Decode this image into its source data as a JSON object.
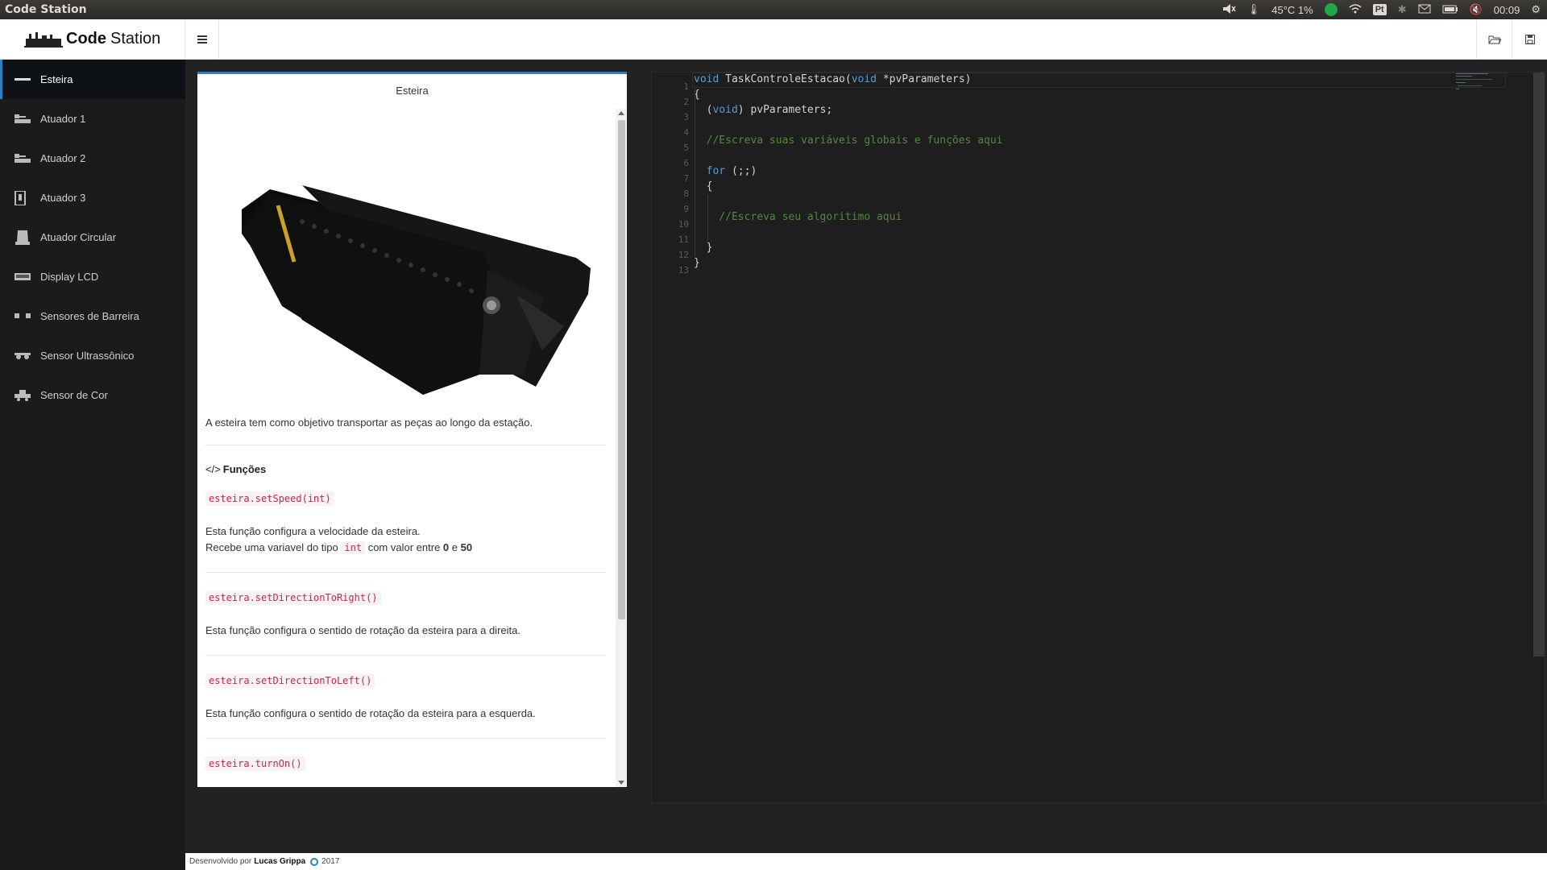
{
  "system_bar": {
    "app_title": "Code Station",
    "temperature": "45°C 1%",
    "keyboard_layout": "Pt",
    "clock": "00:09"
  },
  "header": {
    "brand_bold": "Code",
    "brand_rest": "Station",
    "menu_icon": "hamburger-icon",
    "open_icon": "folder-open-icon",
    "save_icon": "save-icon"
  },
  "sidebar": {
    "items": [
      {
        "label": "Esteira",
        "icon": "conveyor-icon",
        "active": true
      },
      {
        "label": "Atuador 1",
        "icon": "actuator-icon"
      },
      {
        "label": "Atuador 2",
        "icon": "actuator-icon"
      },
      {
        "label": "Atuador 3",
        "icon": "actuator-vertical-icon"
      },
      {
        "label": "Atuador Circular",
        "icon": "circular-actuator-icon"
      },
      {
        "label": "Display LCD",
        "icon": "lcd-icon"
      },
      {
        "label": "Sensores de Barreira",
        "icon": "barrier-sensor-icon"
      },
      {
        "label": "Sensor Ultrassônico",
        "icon": "ultrasonic-sensor-icon"
      },
      {
        "label": "Sensor de Cor",
        "icon": "color-sensor-icon"
      }
    ]
  },
  "doc_panel": {
    "title": "Esteira",
    "description": "A esteira tem como objetivo transportar as peças ao longo da estação.",
    "section_icon": "</>",
    "section_title": "Funções",
    "functions": [
      {
        "signature": "esteira.setSpeed(int)",
        "line1": "Esta função configura a velocidade da esteira.",
        "line2_a": "Recebe uma variavel do tipo",
        "line2_code": "int",
        "line2_b": "com valor entre",
        "min": "0",
        "and": "e",
        "max": "50"
      },
      {
        "signature": "esteira.setDirectionToRight()",
        "line1": "Esta função configura o sentido de rotação da esteira para a direita."
      },
      {
        "signature": "esteira.setDirectionToLeft()",
        "line1": "Esta função configura o sentido de rotação da esteira para a esquerda."
      },
      {
        "signature": "esteira.turnOn()"
      }
    ]
  },
  "editor": {
    "line_numbers": [
      "1",
      "2",
      "3",
      "4",
      "5",
      "6",
      "7",
      "8",
      "9",
      "10",
      "11",
      "12",
      "13"
    ],
    "l1_kw1": "void",
    "l1_fn": " TaskControleEstacao(",
    "l1_kw2": "void",
    "l1_rest": " *pvParameters)",
    "l2": "{",
    "l3_a": "  (",
    "l3_kw": "void",
    "l3_b": ") pvParameters;",
    "l5": "  //Escreva suas variáveis globais e funções aqui",
    "l7_kw": "  for",
    "l7_rest": " (;;)",
    "l8": "  {",
    "l10": "    //Escreva seu algoritimo aqui",
    "l12": "  }",
    "l13": "}"
  },
  "footer": {
    "prefix": "Desenvolvido por",
    "author": "Lucas Grippa",
    "year": "2017"
  }
}
